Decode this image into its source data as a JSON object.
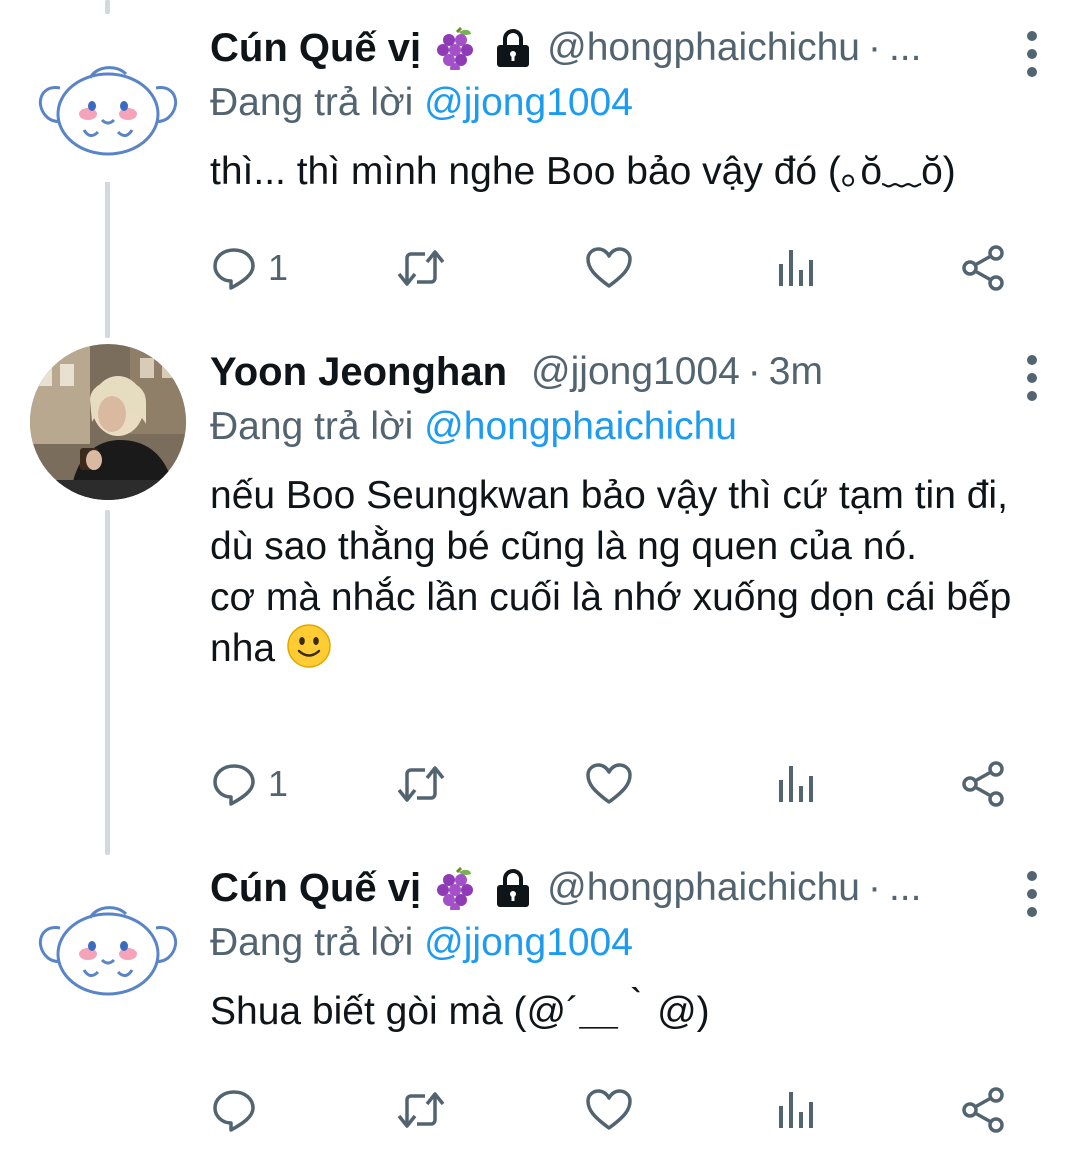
{
  "tweets": [
    {
      "display_name": "Cún Quế vị",
      "handle": "@hongphaichichu",
      "separator": "·",
      "time": "...",
      "reply_prefix": "Đang trả lời",
      "reply_to": "@jjong1004",
      "text": "thì... thì mình nghe Boo bảo vậy đó (｡ŏ﹏ŏ)",
      "reply_count": "1",
      "retweet_count": "",
      "like_count": ""
    },
    {
      "display_name": "Yoon Jeonghan",
      "handle": "@jjong1004",
      "separator": "·",
      "time": "3m",
      "reply_prefix": "Đang trả lời",
      "reply_to": "@hongphaichichu",
      "text": "nếu Boo Seungkwan bảo vậy thì cứ tạm tin đi, dù sao thằng bé cũng là ng quen của nó.\ncơ mà nhắc lần cuối là nhớ xuống dọn cái bếp nha",
      "reply_count": "1",
      "retweet_count": "",
      "like_count": ""
    },
    {
      "display_name": "Cún Quế vị",
      "handle": "@hongphaichichu",
      "separator": "·",
      "time": "...",
      "reply_prefix": "Đang trả lời",
      "reply_to": "@jjong1004",
      "text": "Shua biết gòi mà (@´＿｀@)",
      "reply_count": "",
      "retweet_count": "",
      "like_count": ""
    }
  ],
  "colors": {
    "text_primary": "#0f1419",
    "text_secondary": "#536471",
    "mention": "#1d9bf0",
    "thread_line": "#cfd9de",
    "icon": "#536471"
  },
  "icons": {
    "badges": [
      "grapes-icon",
      "lock-icon"
    ],
    "actions": [
      "reply-icon",
      "retweet-icon",
      "like-icon",
      "analytics-icon",
      "share-icon"
    ],
    "menu": "more-vertical-icon",
    "emoji": "slightly-smiling-face-emoji"
  }
}
